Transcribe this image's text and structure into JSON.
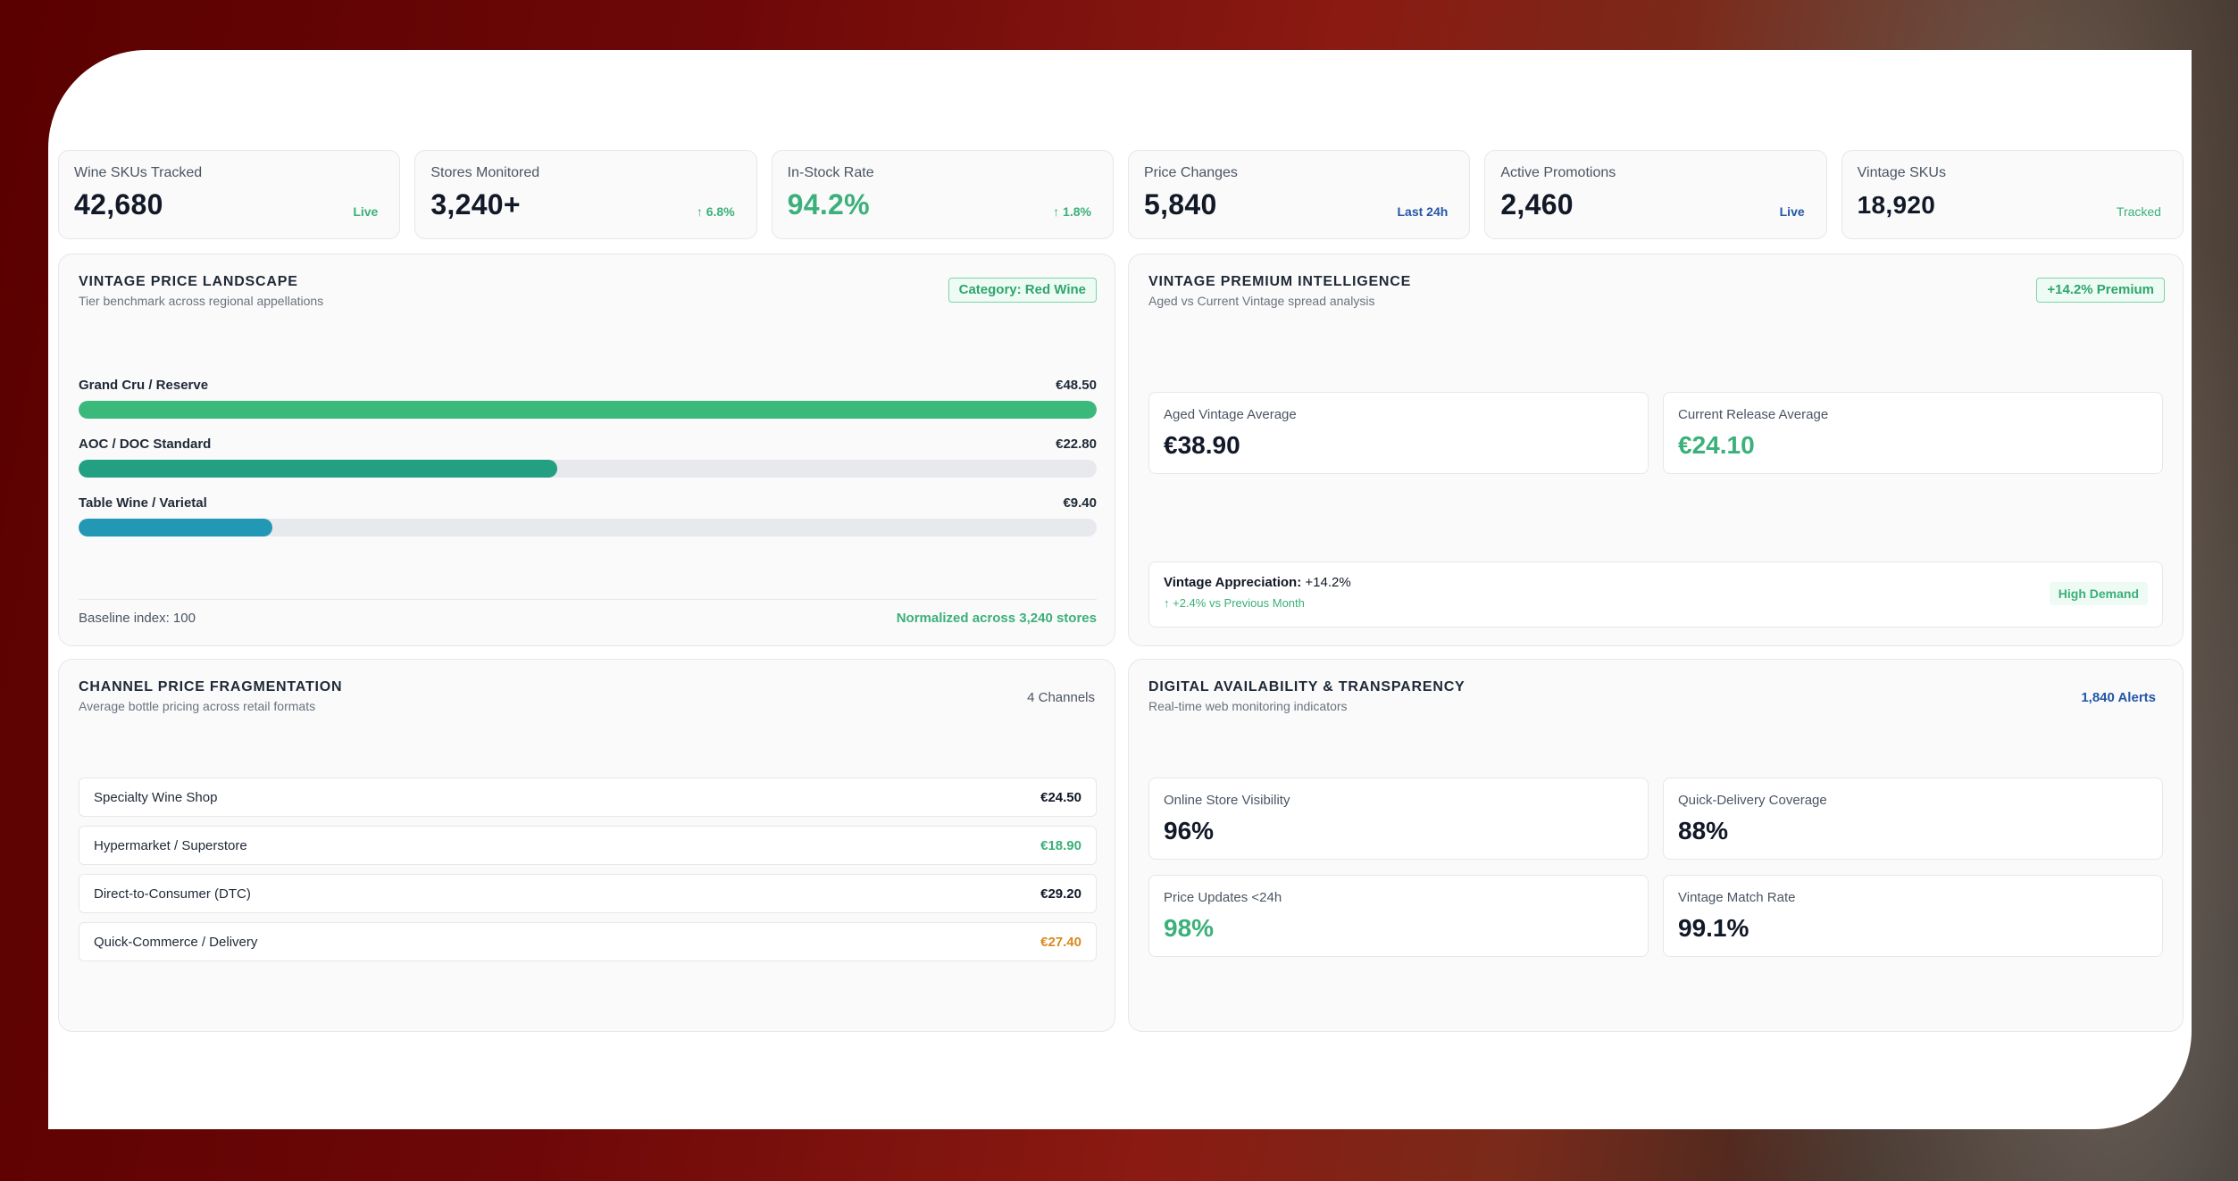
{
  "kpis": [
    {
      "label": "Wine SKUs Tracked",
      "value": "42,680",
      "tag": "Live"
    },
    {
      "label": "Stores Monitored",
      "value": "3,240+",
      "tag": "↑ 6.8%"
    },
    {
      "label": "In-Stock Rate",
      "value": "94.2%",
      "tag": "↑ 1.8%"
    },
    {
      "label": "Price Changes",
      "value": "5,840",
      "tag": "Last 24h"
    },
    {
      "label": "Active Promotions",
      "value": "2,460",
      "tag": "Live"
    },
    {
      "label": "Vintage SKUs",
      "value": "18,920",
      "tag": "Tracked"
    }
  ],
  "landscape": {
    "title": "VINTAGE PRICE LANDSCAPE",
    "subtitle": "Tier benchmark across regional appellations",
    "badge": "Category: Red Wine",
    "tiers": [
      {
        "label": "Grand Cru / Reserve",
        "price": "€48.50",
        "fill": 1.0,
        "color": "#3bb97b"
      },
      {
        "label": "AOC / DOC Standard",
        "price": "€22.80",
        "fill": 0.47,
        "color": "#23a082"
      },
      {
        "label": "Table Wine / Varietal",
        "price": "€9.40",
        "fill": 0.19,
        "color": "#2398b4"
      }
    ],
    "foot_left": "Baseline index: 100",
    "foot_right": "Normalized across 3,240 stores"
  },
  "premium": {
    "title": "VINTAGE PREMIUM INTELLIGENCE",
    "subtitle": "Aged vs Current Vintage spread analysis",
    "badge": "+14.2% Premium",
    "aged_label": "Aged Vintage Average",
    "aged_value": "€38.90",
    "current_label": "Current Release Average",
    "current_value": "€24.10",
    "appreciation_label": "Vintage Appreciation:",
    "appreciation_value": "+14.2%",
    "appreciation_sub": "↑ +2.4% vs Previous Month",
    "demand": "High Demand"
  },
  "channels": {
    "title": "CHANNEL PRICE FRAGMENTATION",
    "subtitle": "Average bottle pricing across retail formats",
    "count": "4 Channels",
    "rows": [
      {
        "name": "Specialty Wine Shop",
        "price": "€24.50"
      },
      {
        "name": "Hypermarket / Superstore",
        "price": "€18.90"
      },
      {
        "name": "Direct-to-Consumer (DTC)",
        "price": "€29.20"
      },
      {
        "name": "Quick-Commerce / Delivery",
        "price": "€27.40"
      }
    ]
  },
  "digital": {
    "title": "DIGITAL AVAILABILITY & TRANSPARENCY",
    "subtitle": "Real-time web monitoring indicators",
    "alerts": "1,840 Alerts",
    "stats": [
      {
        "label": "Online Store Visibility",
        "value": "96%"
      },
      {
        "label": "Quick-Delivery Coverage",
        "value": "88%"
      },
      {
        "label": "Price Updates <24h",
        "value": "98%"
      },
      {
        "label": "Vintage Match Rate",
        "value": "99.1%"
      }
    ]
  }
}
